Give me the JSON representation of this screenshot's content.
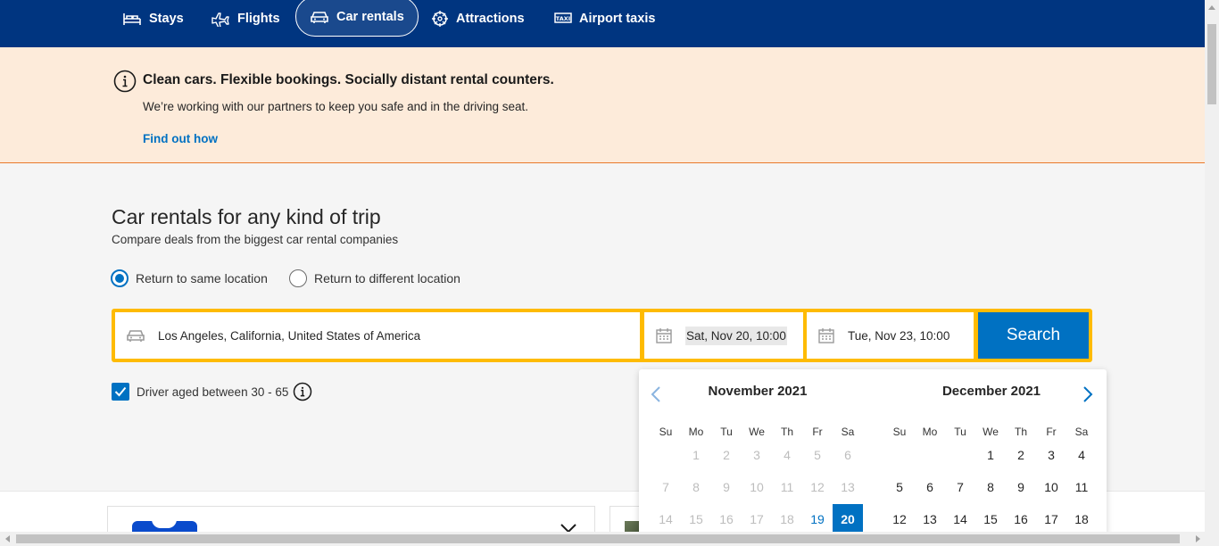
{
  "nav": {
    "items": [
      {
        "label": "Stays",
        "icon": "bed-icon"
      },
      {
        "label": "Flights",
        "icon": "plane-icon"
      },
      {
        "label": "Car rentals",
        "icon": "car-icon",
        "active": true
      },
      {
        "label": "Attractions",
        "icon": "attractions-icon"
      },
      {
        "label": "Airport taxis",
        "icon": "taxi-icon"
      }
    ]
  },
  "banner": {
    "title": "Clean cars. Flexible bookings. Socially distant rental counters.",
    "text": "We’re working with our partners to keep you safe and in the driving seat.",
    "link": "Find out how"
  },
  "main": {
    "title": "Car rentals for any kind of trip",
    "subtitle": "Compare deals from the biggest car rental companies",
    "radio_same": "Return to same location",
    "radio_diff": "Return to different location",
    "location": "Los Angeles, California, United States of America",
    "pickup": "Sat, Nov 20, 10:00",
    "dropoff": "Tue, Nov 23, 10:00",
    "search": "Search",
    "driver_age": "Driver aged between 30 - 65"
  },
  "calendar": {
    "weekdays": [
      "Su",
      "Mo",
      "Tu",
      "We",
      "Th",
      "Fr",
      "Sa"
    ],
    "months": [
      {
        "title": "November 2021",
        "rows": [
          [
            "",
            "1",
            "2",
            "3",
            "4",
            "5",
            "6"
          ],
          [
            "7",
            "8",
            "9",
            "10",
            "11",
            "12",
            "13"
          ],
          [
            "14",
            "15",
            "16",
            "17",
            "18",
            "19",
            "20"
          ]
        ],
        "past_before": 19,
        "today": "19",
        "selected": "20"
      },
      {
        "title": "December 2021",
        "rows": [
          [
            "",
            "",
            "",
            "1",
            "2",
            "3",
            "4"
          ],
          [
            "5",
            "6",
            "7",
            "8",
            "9",
            "10",
            "11"
          ],
          [
            "12",
            "13",
            "14",
            "15",
            "16",
            "17",
            "18"
          ]
        ]
      }
    ]
  },
  "colors": {
    "nav_bg": "#003580",
    "accent": "#0071c2",
    "search_border": "#febb02",
    "banner_bg": "#fdebda"
  }
}
